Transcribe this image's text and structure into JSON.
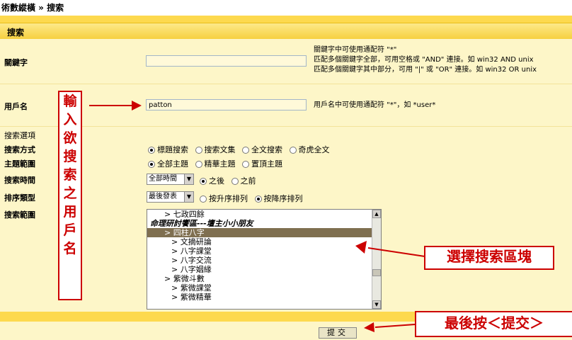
{
  "breadcrumb": "術數縱橫 » 搜索",
  "header": {
    "title": "搜索"
  },
  "keyword": {
    "label": "關鍵字",
    "value": "",
    "help": [
      "關鍵字中可使用通配符 \"*\"",
      "匹配多個關鍵字全部，可用空格或 \"AND\" 連接。如 win32 AND unix",
      "匹配多個關鍵字其中部分，可用 \"|\" 或 \"OR\" 連接。如 win32 OR unix"
    ]
  },
  "username": {
    "label": "用戶名",
    "value": "patton",
    "help": "用戶名中可使用通配符 \"*\"，如 *user*"
  },
  "options_heading": "搜索選項",
  "search_mode": {
    "label": "搜索方式",
    "options": [
      "標題搜索",
      "搜索文集",
      "全文搜索",
      "奇虎全文"
    ],
    "selected": 0
  },
  "topic_range": {
    "label": "主題範圍",
    "options": [
      "全部主題",
      "精華主題",
      "置頂主題"
    ],
    "selected": 0
  },
  "search_time": {
    "label": "搜索時間",
    "select_value": "全部時間",
    "options": [
      "之後",
      "之前"
    ],
    "selected": 0
  },
  "sort_type": {
    "label": "排序類型",
    "select_value": "最後發表",
    "options": [
      "按升序排列",
      "按降序排列"
    ],
    "selected": 1
  },
  "search_range": {
    "label": "搜索範圍",
    "items": [
      {
        "text": "> 七政四餘",
        "indent": 2,
        "kind": "item"
      },
      {
        "text": "命理研討饗區---壇主小小朋友",
        "indent": 0,
        "kind": "group"
      },
      {
        "text": "> 四柱八字",
        "indent": 2,
        "kind": "selected"
      },
      {
        "text": "> 文摘研論",
        "indent": 3,
        "kind": "item"
      },
      {
        "text": "> 八字課堂",
        "indent": 3,
        "kind": "item"
      },
      {
        "text": "> 八字交流",
        "indent": 3,
        "kind": "item"
      },
      {
        "text": "> 八字姻緣",
        "indent": 3,
        "kind": "item"
      },
      {
        "text": "> 紫微斗數",
        "indent": 2,
        "kind": "item"
      },
      {
        "text": "> 紫微課堂",
        "indent": 3,
        "kind": "item"
      },
      {
        "text": "> 紫微精華",
        "indent": 3,
        "kind": "item"
      }
    ]
  },
  "submit_label": "提交",
  "annotations": {
    "username_hint": [
      "輸",
      "入",
      "欲",
      "搜",
      "索",
      "之",
      "用",
      "戶",
      "名"
    ],
    "select_hint": "選擇搜索區塊",
    "submit_hint": "最後按＜提交＞"
  },
  "colors": {
    "annotation": "#cc0000",
    "panel": "#fdf6c8",
    "bar": "#fdd94e"
  }
}
